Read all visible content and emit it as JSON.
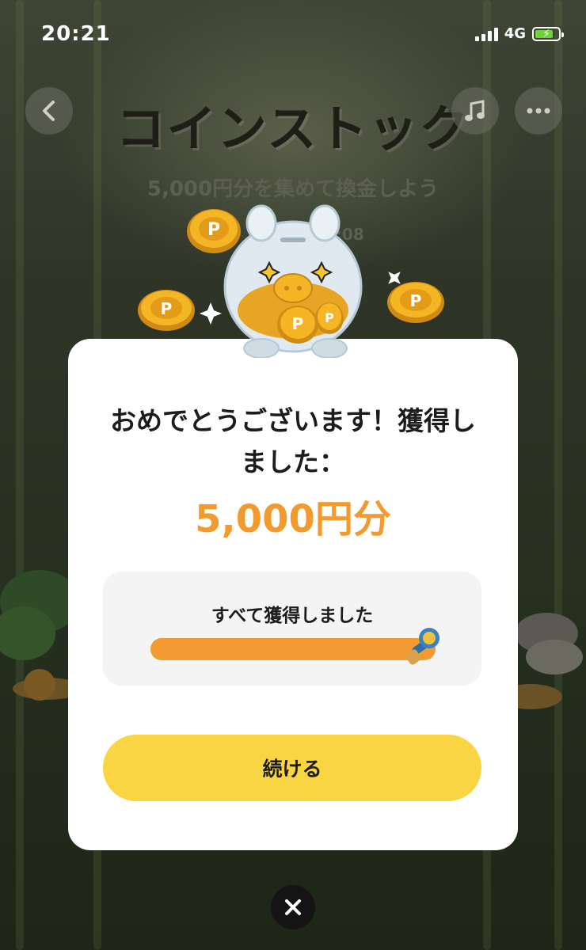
{
  "status_bar": {
    "time": "20:21",
    "network": "4G",
    "battery_icon": "battery-charging-icon"
  },
  "background_page": {
    "title": "コインストック",
    "subtitle": "5,000円分を集めて換金しよう",
    "timer_fragment": "2:08",
    "back_icon": "chevron-left-icon",
    "music_icon": "music-note-icon",
    "more_icon": "more-dots-icon"
  },
  "modal": {
    "message": "おめでとうございます！獲得しました：",
    "amount": "5,000円分",
    "progress": {
      "label": "すべて獲得しました",
      "value_percent": 100
    },
    "continue_label": "続ける",
    "illustration": "piggy-bank-coins-illustration"
  },
  "close_icon": "close-x-icon",
  "colors": {
    "accent_orange": "#f29a2e",
    "button_yellow": "#f9d543",
    "progress_fill": "#f39a32"
  }
}
